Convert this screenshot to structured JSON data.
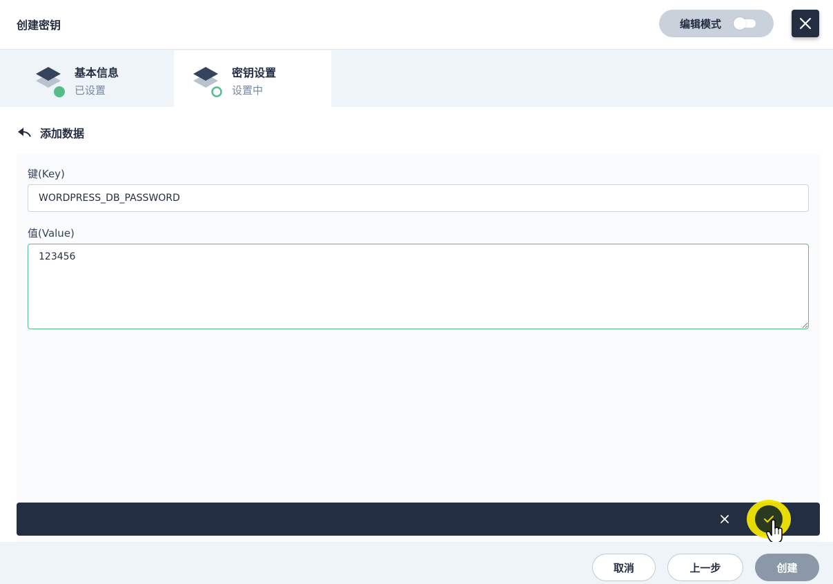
{
  "header": {
    "title": "创建密钥",
    "edit_mode_label": "编辑模式"
  },
  "steps": [
    {
      "title": "基本信息",
      "status": "已设置"
    },
    {
      "title": "密钥设置",
      "status": "设置中"
    }
  ],
  "content": {
    "back_label": "添加数据",
    "key_label": "键(Key)",
    "key_value": "WORDPRESS_DB_PASSWORD",
    "value_label": "值(Value)",
    "value_value": "123456"
  },
  "footer": {
    "cancel_label": "取消",
    "prev_label": "上一步",
    "create_label": "创建"
  },
  "colors": {
    "dark": "#242e42",
    "success": "#55bc8a",
    "highlight": "#f1e600"
  }
}
